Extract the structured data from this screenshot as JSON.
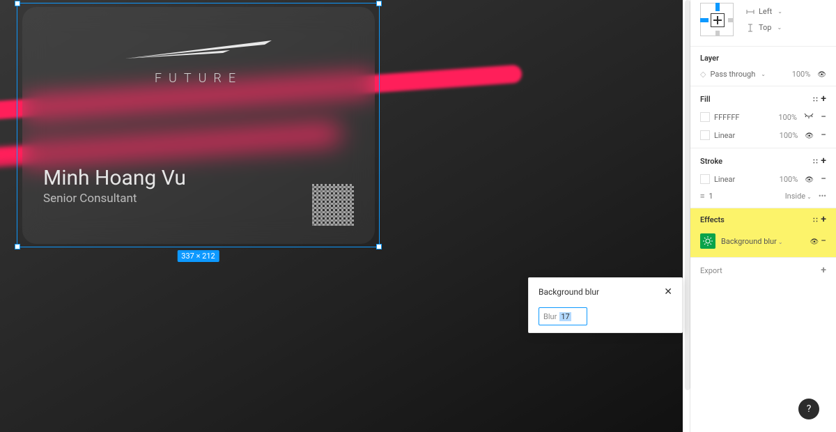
{
  "canvas": {
    "brand": "FUTURE",
    "name": "Minh Hoang Vu",
    "title": "Senior Consultant",
    "selection_dims": "337 × 212"
  },
  "popover": {
    "title": "Background blur",
    "field_label": "Blur",
    "value": "17"
  },
  "inspector": {
    "constraints": {
      "h": "Left",
      "v": "Top"
    },
    "layer": {
      "title": "Layer",
      "mode": "Pass through",
      "opacity": "100%"
    },
    "fill": {
      "title": "Fill",
      "rows": [
        {
          "label": "FFFFFF",
          "value": "100%"
        },
        {
          "label": "Linear",
          "value": "100%"
        }
      ]
    },
    "stroke": {
      "title": "Stroke",
      "row": {
        "label": "Linear",
        "value": "100%"
      },
      "weight": "1",
      "position": "Inside"
    },
    "effects": {
      "title": "Effects",
      "row_label": "Background blur"
    },
    "export": {
      "title": "Export"
    }
  },
  "help": "?"
}
